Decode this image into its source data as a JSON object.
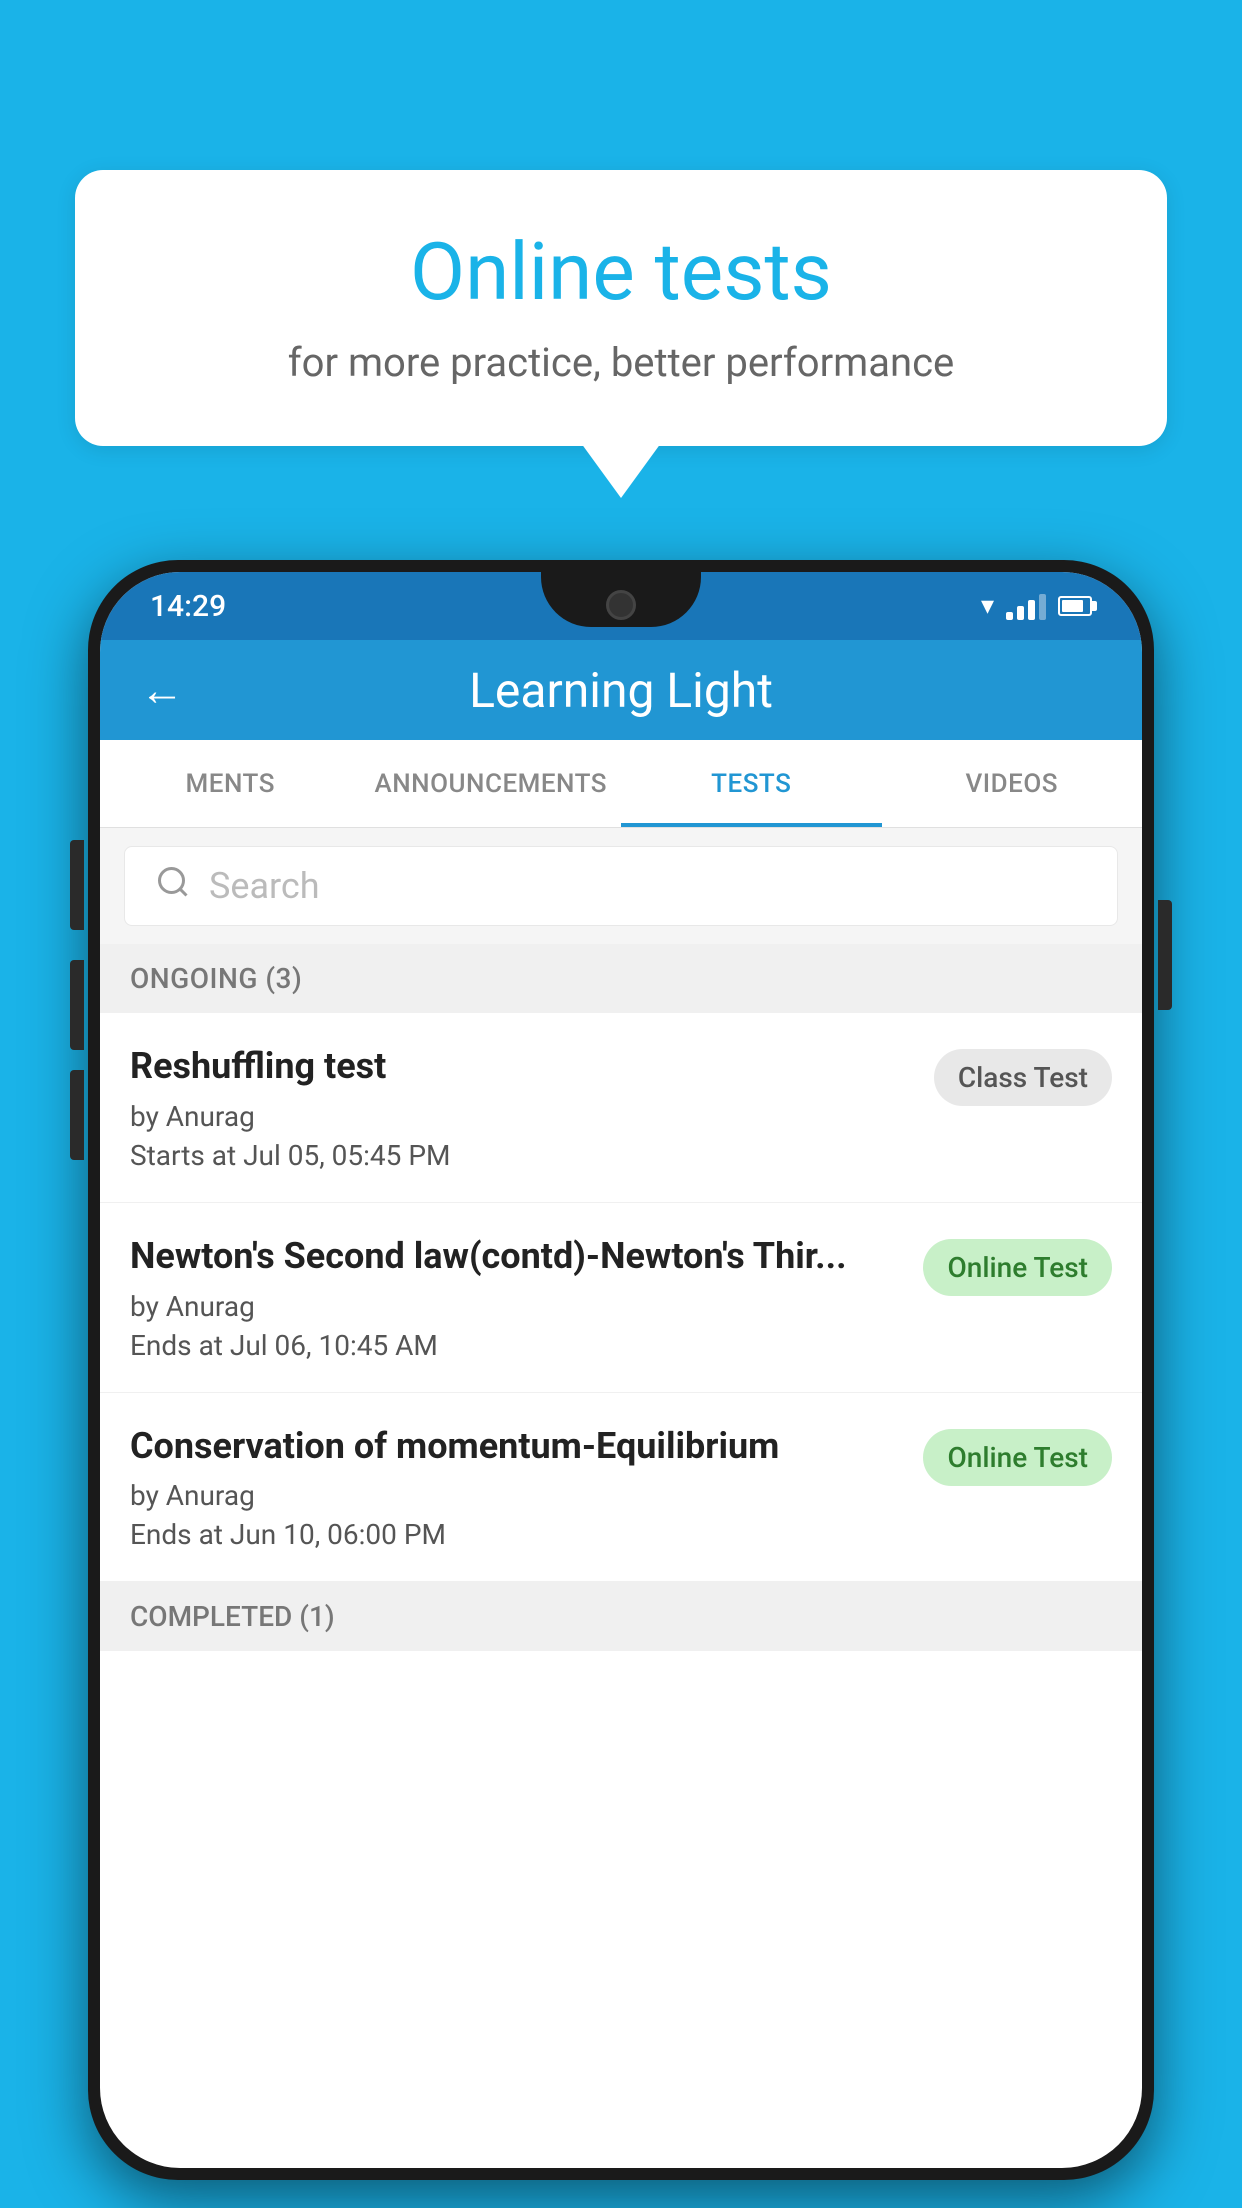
{
  "background_color": "#1ab3e8",
  "speech_bubble": {
    "title": "Online tests",
    "subtitle": "for more practice, better performance"
  },
  "phone": {
    "status_bar": {
      "time": "14:29"
    },
    "header": {
      "title": "Learning Light",
      "back_label": "←"
    },
    "tabs": [
      {
        "label": "MENTS",
        "active": false
      },
      {
        "label": "ANNOUNCEMENTS",
        "active": false
      },
      {
        "label": "TESTS",
        "active": true
      },
      {
        "label": "VIDEOS",
        "active": false
      }
    ],
    "search": {
      "placeholder": "Search"
    },
    "ongoing_section": {
      "label": "ONGOING (3)"
    },
    "test_items": [
      {
        "name": "Reshuffling test",
        "author": "by Anurag",
        "time_label": "Starts at",
        "time": "Jul 05, 05:45 PM",
        "badge": "Class Test",
        "badge_type": "class"
      },
      {
        "name": "Newton's Second law(contd)-Newton's Thir...",
        "author": "by Anurag",
        "time_label": "Ends at",
        "time": "Jul 06, 10:45 AM",
        "badge": "Online Test",
        "badge_type": "online"
      },
      {
        "name": "Conservation of momentum-Equilibrium",
        "author": "by Anurag",
        "time_label": "Ends at",
        "time": "Jun 10, 06:00 PM",
        "badge": "Online Test",
        "badge_type": "online"
      }
    ],
    "completed_section": {
      "label": "COMPLETED (1)"
    }
  }
}
